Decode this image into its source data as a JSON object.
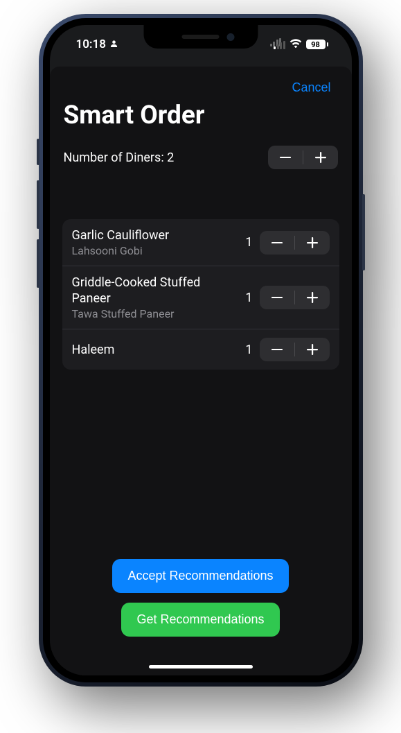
{
  "status": {
    "time": "10:18",
    "battery": "98"
  },
  "sheet": {
    "cancel": "Cancel",
    "title": "Smart Order",
    "diners_label": "Number of Diners: 2"
  },
  "items": [
    {
      "title": "Garlic Cauliflower",
      "subtitle": "Lahsooni Gobi",
      "qty": "1"
    },
    {
      "title": "Griddle-Cooked Stuffed Paneer",
      "subtitle": "Tawa Stuffed Paneer",
      "qty": "1"
    },
    {
      "title": "Haleem",
      "subtitle": "",
      "qty": "1"
    }
  ],
  "buttons": {
    "accept": "Accept Recommendations",
    "get": "Get Recommendations"
  }
}
